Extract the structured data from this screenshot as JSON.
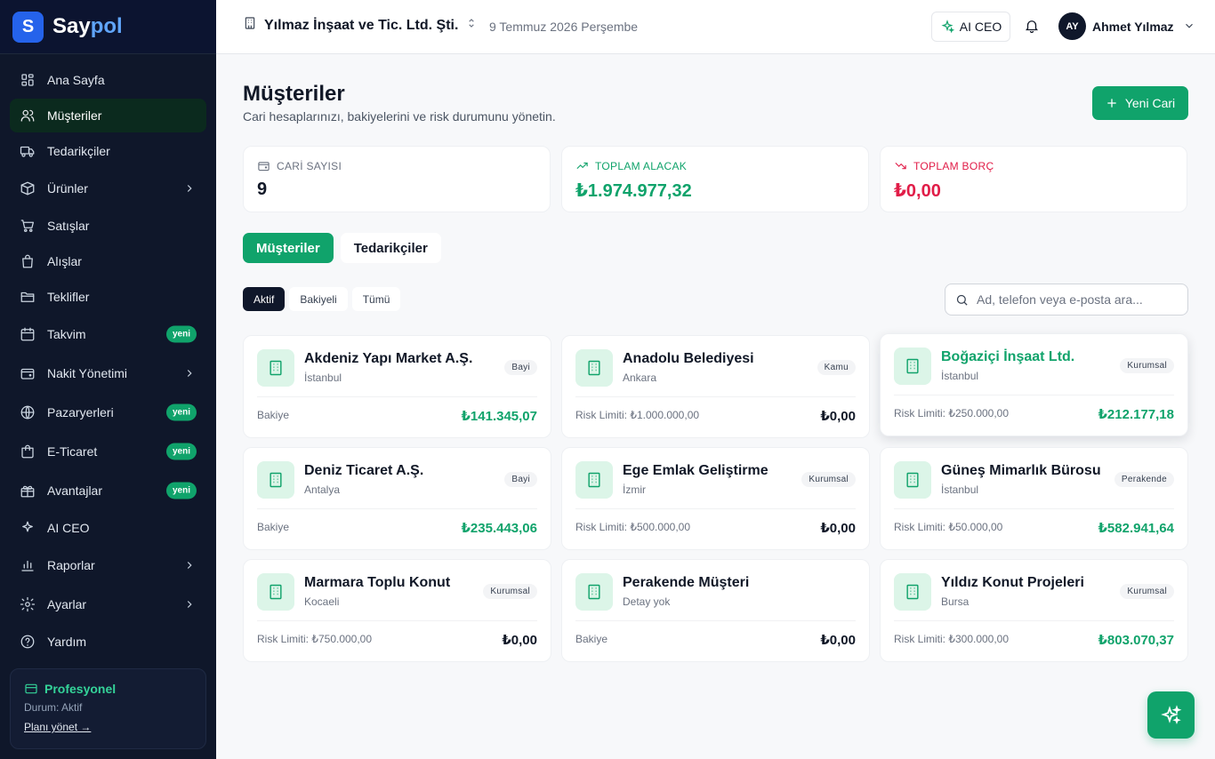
{
  "brand": {
    "logo_letter": "S",
    "name_a": "Say",
    "name_b": "pol"
  },
  "sidebar": {
    "items": [
      {
        "label": "Ana Sayfa",
        "icon": "dashboard-icon"
      },
      {
        "label": "Müşteriler",
        "icon": "users-icon",
        "active": true
      },
      {
        "label": "Tedarikçiler",
        "icon": "truck-icon"
      },
      {
        "label": "Ürünler",
        "icon": "box-icon",
        "chevron": true
      },
      {
        "label": "Satışlar",
        "icon": "cart-icon"
      },
      {
        "label": "Alışlar",
        "icon": "bag-icon"
      },
      {
        "label": "Teklifler",
        "icon": "folder-icon"
      },
      {
        "label": "Takvim",
        "icon": "calendar-icon",
        "badge": "yeni"
      },
      {
        "label": "Nakit Yönetimi",
        "icon": "wallet-icon",
        "chevron": true
      },
      {
        "label": "Pazaryerleri",
        "icon": "globe-icon",
        "badge": "yeni"
      },
      {
        "label": "E-Ticaret",
        "icon": "shopping-bag-icon",
        "badge": "yeni"
      },
      {
        "label": "Avantajlar",
        "icon": "gift-icon",
        "badge": "yeni"
      },
      {
        "label": "AI CEO",
        "icon": "sparkle-icon"
      },
      {
        "label": "Raporlar",
        "icon": "chart-icon",
        "chevron": true
      },
      {
        "label": "Ayarlar",
        "icon": "gear-icon",
        "chevron": true
      },
      {
        "label": "Yardım",
        "icon": "help-icon"
      }
    ],
    "plan": {
      "title": "Profesyonel",
      "status": "Durum: Aktif",
      "link": "Planı yönet →"
    }
  },
  "topbar": {
    "company": "Yılmaz İnşaat ve Tic. Ltd. Şti.",
    "date": "9 Temmuz 2026 Perşembe",
    "ai_button": "AI CEO",
    "user_initials": "AY",
    "user_name": "Ahmet Yılmaz"
  },
  "page": {
    "title": "Müşteriler",
    "subtitle": "Cari hesaplarınızı, bakiyelerini ve risk durumunu yönetin.",
    "new_button": "Yeni Cari"
  },
  "stats": [
    {
      "label": "CARİ SAYISI",
      "value": "9",
      "color": "#111827",
      "label_color": "#6b7280",
      "icon": "wallet-icon"
    },
    {
      "label": "TOPLAM ALACAK",
      "value": "₺1.974.977,32",
      "color": "#10a36b",
      "label_color": "#10a36b",
      "icon": "trend-up-icon"
    },
    {
      "label": "TOPLAM BORÇ",
      "value": "₺0,00",
      "color": "#e11d48",
      "label_color": "#e11d48",
      "icon": "trend-down-icon"
    }
  ],
  "tabs": [
    "Müşteriler",
    "Tedarikçiler"
  ],
  "filters": [
    "Aktif",
    "Bakiyeli",
    "Tümü"
  ],
  "search": {
    "placeholder": "Ad, telefon veya e-posta ara..."
  },
  "customers": [
    {
      "name": "Akdeniz Yapı Market A.Ş.",
      "city": "İstanbul",
      "type": "Bayi",
      "foot": "Bakiye",
      "balance": "₺141.345,07",
      "positive": true
    },
    {
      "name": "Anadolu Belediyesi",
      "city": "Ankara",
      "type": "Kamu",
      "foot": "Risk Limiti: ₺1.000.000,00",
      "balance": "₺0,00",
      "positive": false
    },
    {
      "name": "Boğaziçi İnşaat Ltd.",
      "city": "İstanbul",
      "type": "Kurumsal",
      "foot": "Risk Limiti: ₺250.000,00",
      "balance": "₺212.177,18",
      "positive": true,
      "highlight": true
    },
    {
      "name": "Deniz Ticaret A.Ş.",
      "city": "Antalya",
      "type": "Bayi",
      "foot": "Bakiye",
      "balance": "₺235.443,06",
      "positive": true
    },
    {
      "name": "Ege Emlak Geliştirme",
      "city": "İzmir",
      "type": "Kurumsal",
      "foot": "Risk Limiti: ₺500.000,00",
      "balance": "₺0,00",
      "positive": false
    },
    {
      "name": "Güneş Mimarlık Bürosu",
      "city": "İstanbul",
      "type": "Perakende",
      "foot": "Risk Limiti: ₺50.000,00",
      "balance": "₺582.941,64",
      "positive": true
    },
    {
      "name": "Marmara Toplu Konut",
      "city": "Kocaeli",
      "type": "Kurumsal",
      "foot": "Risk Limiti: ₺750.000,00",
      "balance": "₺0,00",
      "positive": false
    },
    {
      "name": "Perakende Müşteri",
      "city": "Detay yok",
      "type": "",
      "foot": "Bakiye",
      "balance": "₺0,00",
      "positive": false
    },
    {
      "name": "Yıldız Konut Projeleri",
      "city": "Bursa",
      "type": "Kurumsal",
      "foot": "Risk Limiti: ₺300.000,00",
      "balance": "₺803.070,37",
      "positive": true
    }
  ],
  "colors": {
    "accent": "#10a36b",
    "sidebar_bg": "#0f172a",
    "negative": "#e11d48"
  }
}
